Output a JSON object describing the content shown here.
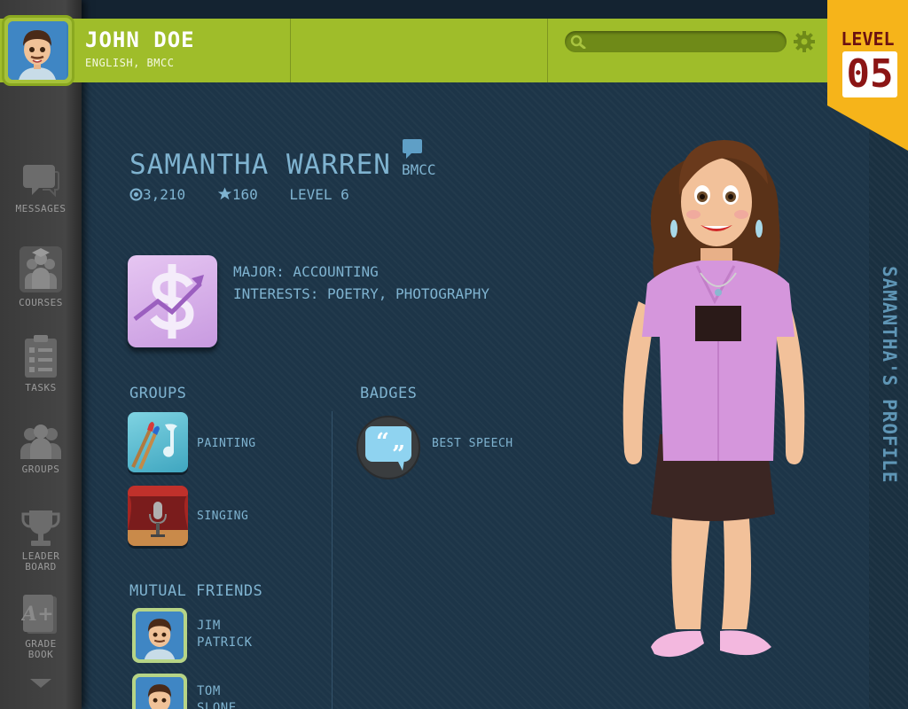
{
  "user": {
    "name": "JOHN DOE",
    "subtitle": "ENGLISH, BMCC"
  },
  "level_flag": {
    "label": "LEVEL",
    "number": "05"
  },
  "search": {
    "placeholder": "",
    "icon": "search-icon"
  },
  "sidebar": {
    "items": [
      {
        "label": "MESSAGES",
        "icon": "messages-icon"
      },
      {
        "label": "COURSES",
        "icon": "courses-icon"
      },
      {
        "label": "TASKS",
        "icon": "tasks-icon"
      },
      {
        "label": "GROUPS",
        "icon": "groups-icon"
      },
      {
        "label_line1": "LEADER",
        "label_line2": "BOARD",
        "icon": "trophy-icon"
      },
      {
        "label_line1": "GRADE",
        "label_line2": "BOOK",
        "icon": "gradebook-icon"
      }
    ]
  },
  "profile": {
    "name": "SAMANTHA WARREN",
    "school": "BMCC",
    "points": "3,210",
    "stars": "160",
    "level": "LEVEL 6",
    "major": "MAJOR: ACCOUNTING",
    "interests": "INTERESTS: POETRY, PHOTOGRAPHY",
    "vertical_title": "SAMANTHA'S PROFILE"
  },
  "groups": {
    "title": "GROUPS",
    "items": [
      {
        "label": "PAINTING",
        "icon": "painting-icon"
      },
      {
        "label": "SINGING",
        "icon": "microphone-icon"
      }
    ]
  },
  "badges": {
    "title": "BADGES",
    "items": [
      {
        "label": "BEST SPEECH",
        "icon": "quote-bubble-icon"
      }
    ]
  },
  "mutual_friends": {
    "title": "MUTUAL FRIENDS",
    "items": [
      {
        "first": "JIM",
        "last": "PATRICK"
      },
      {
        "first": "TOM",
        "last": "SLONE"
      }
    ]
  },
  "colors": {
    "header_green": "#9fbd2a",
    "level_flag": "#f6b41a",
    "level_text": "#8b1515",
    "panel_bg": "#1d3548",
    "text_blue": "#7fb3d0",
    "sidebar_gray": "#3f3f3f"
  }
}
